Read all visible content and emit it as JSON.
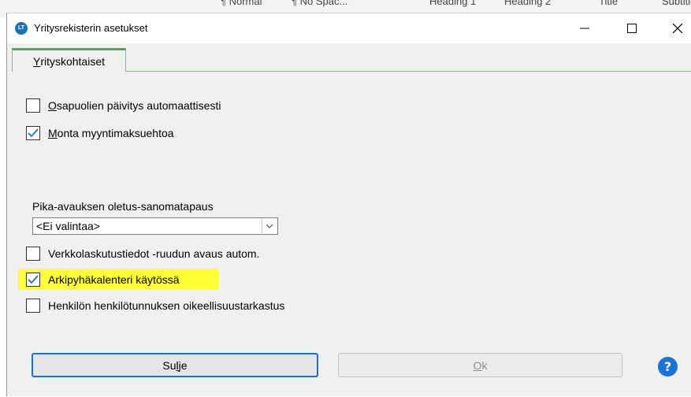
{
  "background_window": {
    "strip_text": [
      "¶ Normal",
      "¶ No Spac...",
      "Heading 1",
      "Heading 2",
      "Title",
      "Subtitle"
    ]
  },
  "dialog": {
    "title": "Yritysrekisterin asetukset",
    "app_icon_text": "LT",
    "tab_label_prefix": "Y",
    "tab_label_rest": "rityskohtaiset",
    "options": [
      {
        "first": "O",
        "rest": "sapuolien päivitys automaattisesti",
        "checked": false
      },
      {
        "first": "M",
        "rest": "onta myyntimaksuehtoa",
        "checked": true
      },
      {
        "first": "",
        "rest": "Verkkolaskutustiedot -ruudun avaus autom.",
        "checked": false
      },
      {
        "first": "",
        "rest": "Arkipyhäkalenteri käytössä",
        "checked": true,
        "highlighted": true
      },
      {
        "first": "",
        "rest": "Henkilön henkilötunnuksen oikeellisuustarkastus",
        "checked": false
      }
    ],
    "dropdown_label": "Pika-avauksen oletus-sanomatapaus",
    "dropdown_value": "<Ei valintaa>",
    "close_button_prefix": "Su",
    "close_button_ul": "l",
    "close_button_rest": "je",
    "ok_button_ul": "O",
    "ok_button_rest": "k",
    "help_label": "?"
  },
  "colors": {
    "accent_blue": "#1e6fc7",
    "tab_green": "#5aa05a",
    "highlight_yellow": "#ffff33"
  }
}
